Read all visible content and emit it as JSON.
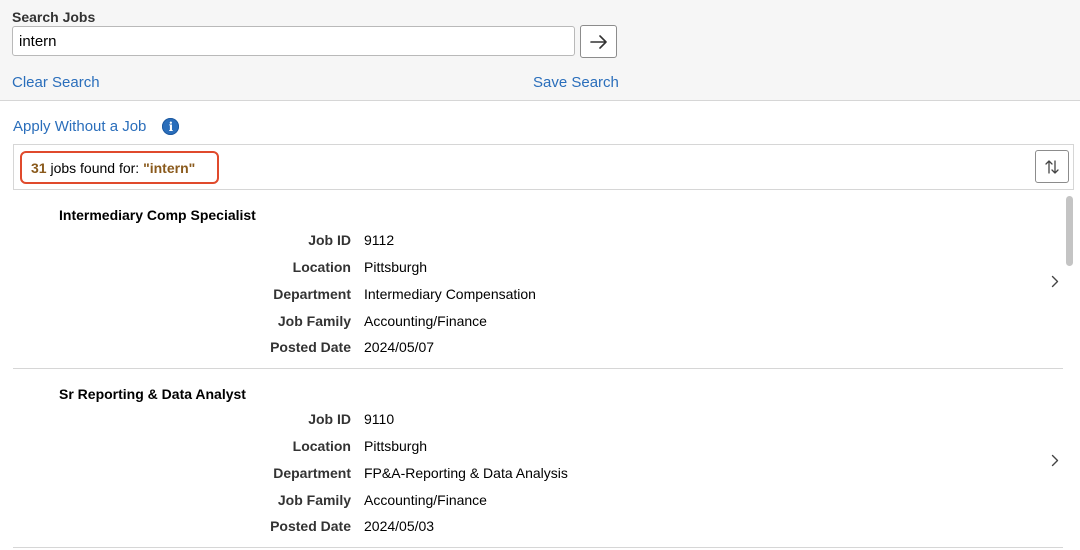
{
  "search": {
    "label": "Search Jobs",
    "value": "intern",
    "placeholder": "",
    "clear_label": "Clear Search",
    "save_label": "Save Search"
  },
  "apply_without_job": "Apply Without a Job",
  "results": {
    "count": "31",
    "text": " jobs found for: ",
    "query": "\"intern\""
  },
  "field_labels": {
    "job_id": "Job ID",
    "location": "Location",
    "department": "Department",
    "job_family": "Job Family",
    "posted_date": "Posted Date"
  },
  "jobs": [
    {
      "title": "Intermediary Comp Specialist",
      "job_id": "9112",
      "location": "Pittsburgh",
      "department": "Intermediary Compensation",
      "job_family": "Accounting/Finance",
      "posted_date": "2024/05/07"
    },
    {
      "title": "Sr Reporting & Data Analyst",
      "job_id": "9110",
      "location": "Pittsburgh",
      "department": "FP&A-Reporting & Data Analysis",
      "job_family": "Accounting/Finance",
      "posted_date": "2024/05/03"
    }
  ],
  "icons": {
    "go": "arrow-right-icon",
    "info": "info-icon",
    "sort": "sort-icon",
    "row": "chevron-right-icon"
  },
  "colors": {
    "link": "#2a6ebb",
    "accent": "#8a5a1c",
    "highlight_border": "#e04a2c"
  }
}
